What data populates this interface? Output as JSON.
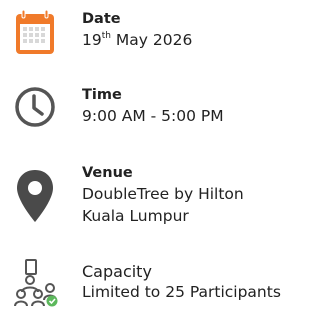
{
  "date": {
    "title": "Date",
    "day": "19",
    "suffix": "th",
    "rest": "May 2026",
    "icon": "calendar-icon",
    "color": "#f07a2a"
  },
  "time": {
    "title": "Time",
    "value": "9:00 AM - 5:00 PM",
    "icon": "clock-icon"
  },
  "venue": {
    "title": "Venue",
    "line1": "DoubleTree by Hilton",
    "line2": "Kuala Lumpur",
    "icon": "location-pin-icon"
  },
  "capacity": {
    "title": "Capacity",
    "value": "Limited to 25 Participants",
    "icon": "people-group-icon"
  }
}
